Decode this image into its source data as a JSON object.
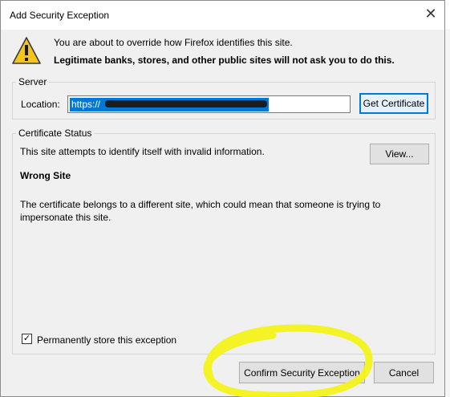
{
  "dialog": {
    "title": "Add Security Exception",
    "close_symbol": "✕"
  },
  "warning": {
    "icon": "warning-triangle-icon",
    "line1": "You are about to override how Firefox identifies this site.",
    "line2": "Legitimate banks, stores, and other public sites will not ask you to do this."
  },
  "server": {
    "group_label": "Server",
    "location_label": "Location:",
    "location_value": "https://",
    "get_certificate_label": "Get Certificate"
  },
  "certificate_status": {
    "group_label": "Certificate Status",
    "status_text": "This site attempts to identify itself with invalid information.",
    "view_label": "View...",
    "heading": "Wrong Site",
    "description": "The certificate belongs to a different site, which could mean that someone is trying to impersonate this site."
  },
  "permanent": {
    "checked": true,
    "check_symbol": "✓",
    "label": "Permanently store this exception"
  },
  "buttons": {
    "confirm_label": "Confirm Security Exception",
    "cancel_label": "Cancel"
  },
  "colors": {
    "selection": "#0078d7",
    "highlight_marker": "#f2f21a",
    "warning_yellow": "#f5c518"
  }
}
